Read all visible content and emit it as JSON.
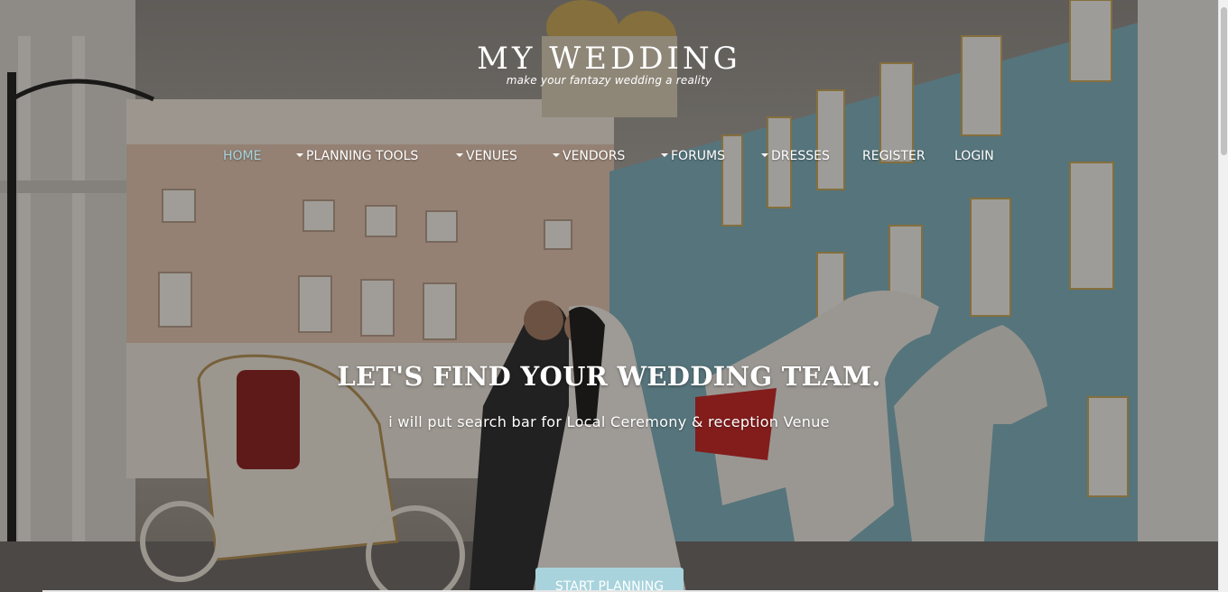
{
  "brand": {
    "title": "MY WEDDING",
    "tagline": "make your fantazy wedding a reality"
  },
  "nav": {
    "items": [
      {
        "label": "HOME",
        "active": true,
        "dropdown": false
      },
      {
        "label": "PLANNING TOOLS",
        "active": false,
        "dropdown": true
      },
      {
        "label": "VENUES",
        "active": false,
        "dropdown": true
      },
      {
        "label": "VENDORS",
        "active": false,
        "dropdown": true
      },
      {
        "label": "FORUMS",
        "active": false,
        "dropdown": true
      },
      {
        "label": "DRESSES",
        "active": false,
        "dropdown": true
      },
      {
        "label": "REGISTER",
        "active": false,
        "dropdown": false
      },
      {
        "label": "LOGIN",
        "active": false,
        "dropdown": false
      }
    ]
  },
  "hero": {
    "headline": "LET'S FIND YOUR WEDDING TEAM.",
    "subline": "i will put search bar for Local Ceremony & reception Venue",
    "cta_label": "START PLANNING",
    "background": "wedding-couple-carriage-photo"
  },
  "colors": {
    "accent": "#a8d3dc",
    "text": "#ffffff"
  }
}
